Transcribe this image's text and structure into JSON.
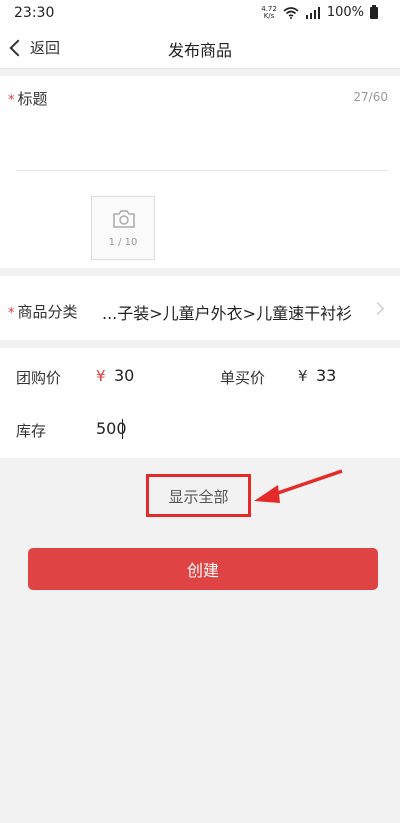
{
  "status_bar": {
    "time": "23:30",
    "net_speed_top": "4.72",
    "net_speed_bottom": "K/s",
    "battery": "100%"
  },
  "nav": {
    "back_label": "返回",
    "title": "发布商品"
  },
  "title_field": {
    "required_mark": "*",
    "label": "标题",
    "counter": "27/60",
    "value": ""
  },
  "photo": {
    "count": "1 / 10",
    "icon": "camera-icon"
  },
  "category": {
    "required_mark": "*",
    "label": "商品分类",
    "value": "...子装>儿童户外衣>儿童速干衬衫"
  },
  "pricing": {
    "group_price_label": "团购价",
    "group_price_symbol": "¥",
    "group_price_value": "30",
    "single_price_label": "单买价",
    "single_price_symbol": "¥",
    "single_price_value": "33"
  },
  "stock": {
    "label": "库存",
    "value": "500"
  },
  "actions": {
    "show_all_label": "显示全部",
    "create_label": "创建"
  },
  "colors": {
    "accent_red": "#df4343",
    "highlight_red": "#e52a2a"
  }
}
